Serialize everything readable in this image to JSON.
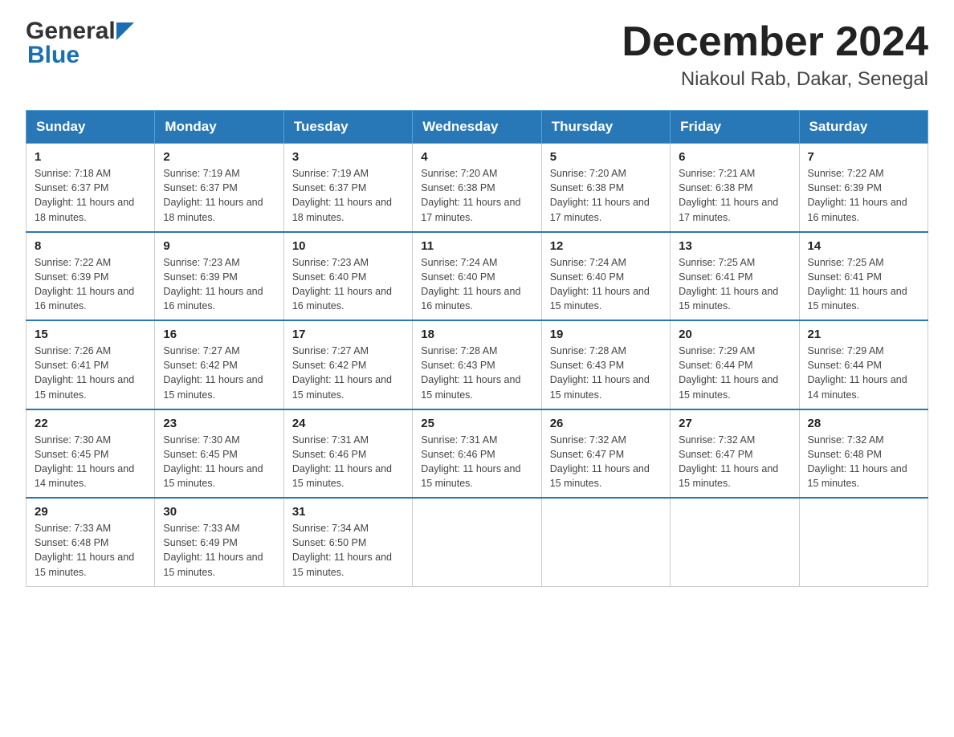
{
  "logo": {
    "general": "General",
    "blue": "Blue"
  },
  "title": "December 2024",
  "subtitle": "Niakoul Rab, Dakar, Senegal",
  "days_of_week": [
    "Sunday",
    "Monday",
    "Tuesday",
    "Wednesday",
    "Thursday",
    "Friday",
    "Saturday"
  ],
  "weeks": [
    [
      {
        "day": "1",
        "sunrise": "7:18 AM",
        "sunset": "6:37 PM",
        "daylight": "11 hours and 18 minutes."
      },
      {
        "day": "2",
        "sunrise": "7:19 AM",
        "sunset": "6:37 PM",
        "daylight": "11 hours and 18 minutes."
      },
      {
        "day": "3",
        "sunrise": "7:19 AM",
        "sunset": "6:37 PM",
        "daylight": "11 hours and 18 minutes."
      },
      {
        "day": "4",
        "sunrise": "7:20 AM",
        "sunset": "6:38 PM",
        "daylight": "11 hours and 17 minutes."
      },
      {
        "day": "5",
        "sunrise": "7:20 AM",
        "sunset": "6:38 PM",
        "daylight": "11 hours and 17 minutes."
      },
      {
        "day": "6",
        "sunrise": "7:21 AM",
        "sunset": "6:38 PM",
        "daylight": "11 hours and 17 minutes."
      },
      {
        "day": "7",
        "sunrise": "7:22 AM",
        "sunset": "6:39 PM",
        "daylight": "11 hours and 16 minutes."
      }
    ],
    [
      {
        "day": "8",
        "sunrise": "7:22 AM",
        "sunset": "6:39 PM",
        "daylight": "11 hours and 16 minutes."
      },
      {
        "day": "9",
        "sunrise": "7:23 AM",
        "sunset": "6:39 PM",
        "daylight": "11 hours and 16 minutes."
      },
      {
        "day": "10",
        "sunrise": "7:23 AM",
        "sunset": "6:40 PM",
        "daylight": "11 hours and 16 minutes."
      },
      {
        "day": "11",
        "sunrise": "7:24 AM",
        "sunset": "6:40 PM",
        "daylight": "11 hours and 16 minutes."
      },
      {
        "day": "12",
        "sunrise": "7:24 AM",
        "sunset": "6:40 PM",
        "daylight": "11 hours and 15 minutes."
      },
      {
        "day": "13",
        "sunrise": "7:25 AM",
        "sunset": "6:41 PM",
        "daylight": "11 hours and 15 minutes."
      },
      {
        "day": "14",
        "sunrise": "7:25 AM",
        "sunset": "6:41 PM",
        "daylight": "11 hours and 15 minutes."
      }
    ],
    [
      {
        "day": "15",
        "sunrise": "7:26 AM",
        "sunset": "6:41 PM",
        "daylight": "11 hours and 15 minutes."
      },
      {
        "day": "16",
        "sunrise": "7:27 AM",
        "sunset": "6:42 PM",
        "daylight": "11 hours and 15 minutes."
      },
      {
        "day": "17",
        "sunrise": "7:27 AM",
        "sunset": "6:42 PM",
        "daylight": "11 hours and 15 minutes."
      },
      {
        "day": "18",
        "sunrise": "7:28 AM",
        "sunset": "6:43 PM",
        "daylight": "11 hours and 15 minutes."
      },
      {
        "day": "19",
        "sunrise": "7:28 AM",
        "sunset": "6:43 PM",
        "daylight": "11 hours and 15 minutes."
      },
      {
        "day": "20",
        "sunrise": "7:29 AM",
        "sunset": "6:44 PM",
        "daylight": "11 hours and 15 minutes."
      },
      {
        "day": "21",
        "sunrise": "7:29 AM",
        "sunset": "6:44 PM",
        "daylight": "11 hours and 14 minutes."
      }
    ],
    [
      {
        "day": "22",
        "sunrise": "7:30 AM",
        "sunset": "6:45 PM",
        "daylight": "11 hours and 14 minutes."
      },
      {
        "day": "23",
        "sunrise": "7:30 AM",
        "sunset": "6:45 PM",
        "daylight": "11 hours and 15 minutes."
      },
      {
        "day": "24",
        "sunrise": "7:31 AM",
        "sunset": "6:46 PM",
        "daylight": "11 hours and 15 minutes."
      },
      {
        "day": "25",
        "sunrise": "7:31 AM",
        "sunset": "6:46 PM",
        "daylight": "11 hours and 15 minutes."
      },
      {
        "day": "26",
        "sunrise": "7:32 AM",
        "sunset": "6:47 PM",
        "daylight": "11 hours and 15 minutes."
      },
      {
        "day": "27",
        "sunrise": "7:32 AM",
        "sunset": "6:47 PM",
        "daylight": "11 hours and 15 minutes."
      },
      {
        "day": "28",
        "sunrise": "7:32 AM",
        "sunset": "6:48 PM",
        "daylight": "11 hours and 15 minutes."
      }
    ],
    [
      {
        "day": "29",
        "sunrise": "7:33 AM",
        "sunset": "6:48 PM",
        "daylight": "11 hours and 15 minutes."
      },
      {
        "day": "30",
        "sunrise": "7:33 AM",
        "sunset": "6:49 PM",
        "daylight": "11 hours and 15 minutes."
      },
      {
        "day": "31",
        "sunrise": "7:34 AM",
        "sunset": "6:50 PM",
        "daylight": "11 hours and 15 minutes."
      },
      null,
      null,
      null,
      null
    ]
  ],
  "sunrise_label": "Sunrise:",
  "sunset_label": "Sunset:",
  "daylight_label": "Daylight:"
}
